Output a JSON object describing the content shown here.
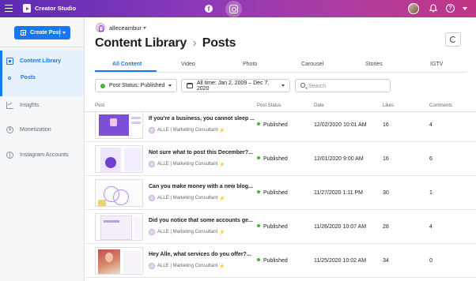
{
  "topbar": {
    "app_title": "Creator Studio",
    "icons": [
      "menu-icon",
      "creator-studio-icon",
      "facebook-icon",
      "instagram-icon",
      "profile-avatar",
      "bell-icon",
      "help-icon",
      "chevron-down-icon"
    ],
    "help_glyph": "?",
    "fb_glyph": "f"
  },
  "sidebar": {
    "create_post_label": "Create Post",
    "items": [
      {
        "label": "Content Library",
        "icon": "library-icon",
        "active": true
      },
      {
        "label": "Posts",
        "sub": true,
        "active": true
      },
      {
        "label": "Insights",
        "icon": "insights-icon"
      },
      {
        "label": "Monetization",
        "icon": "money-icon"
      },
      {
        "label": "Instagram Accounts",
        "icon": "instagram-accounts-icon"
      }
    ],
    "money_glyph": "$"
  },
  "header": {
    "account_name": "alleceambur",
    "breadcrumb": "Content Library",
    "separator": "›",
    "page": "Posts"
  },
  "tabs": [
    "All Content",
    "Video",
    "Photo",
    "Carousel",
    "Stories",
    "IGTV"
  ],
  "filters": {
    "status": "Post Status: Published",
    "date": "All time: Jan 2, 2009 – Dec 7, 2020",
    "search_placeholder": "Search"
  },
  "table": {
    "columns": [
      "Post",
      "Post Status",
      "Date",
      "Likes",
      "Comments"
    ],
    "rows": [
      {
        "title": "If you're a business, you cannot sleep ...",
        "author": "ALLE | Marketing Consultant",
        "status": "Published",
        "date": "12/02/2020 10:01 AM",
        "likes": "16",
        "comments": "4"
      },
      {
        "title": "Not sure what to post this December?...",
        "author": "ALLE | Marketing Consultant",
        "status": "Published",
        "date": "12/01/2020 9:00 AM",
        "likes": "16",
        "comments": "6"
      },
      {
        "title": "Can you make money with a new blog...",
        "author": "ALLE | Marketing Consultant",
        "status": "Published",
        "date": "11/27/2020 1:11 PM",
        "likes": "30",
        "comments": "1"
      },
      {
        "title": "Did you notice that some accounts ge...",
        "author": "ALLE | Marketing Consultant",
        "status": "Published",
        "date": "11/26/2020 10:07 AM",
        "likes": "28",
        "comments": "4"
      },
      {
        "title": "Hey Alle, what services do you offer?...",
        "author": "ALLE | Marketing Consultant",
        "status": "Published",
        "date": "11/25/2020 10:02 AM",
        "likes": "34",
        "comments": "0"
      }
    ],
    "bolt_glyph": "⚡"
  },
  "colors": {
    "accent": "#1877f2",
    "published": "#42b72a",
    "topbar_start": "#5b2bb3",
    "topbar_end": "#c13584"
  }
}
